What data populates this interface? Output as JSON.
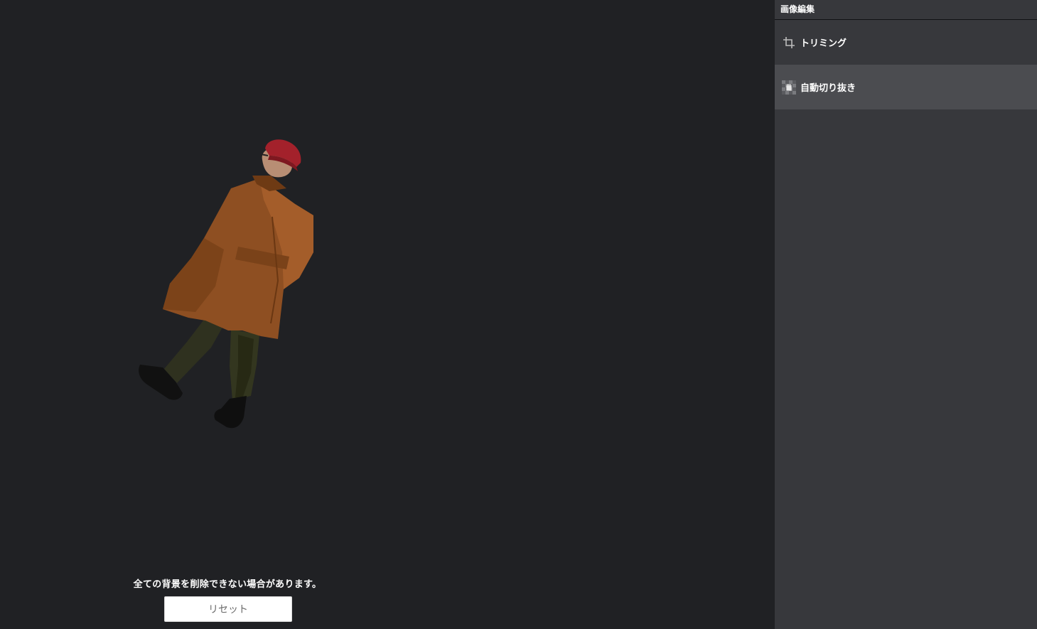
{
  "panel": {
    "title": "画像編集",
    "tools": [
      {
        "label": "トリミング",
        "icon": "crop-icon",
        "active": false
      },
      {
        "label": "自動切り抜き",
        "icon": "auto-cutout-icon",
        "active": true
      }
    ]
  },
  "canvas": {
    "notice": "全ての背景を削除できない場合があります。",
    "reset_label": "リセット"
  },
  "colors": {
    "canvas_bg": "#202124",
    "panel_bg": "#37383c",
    "active_item_bg": "#4b4c50"
  }
}
